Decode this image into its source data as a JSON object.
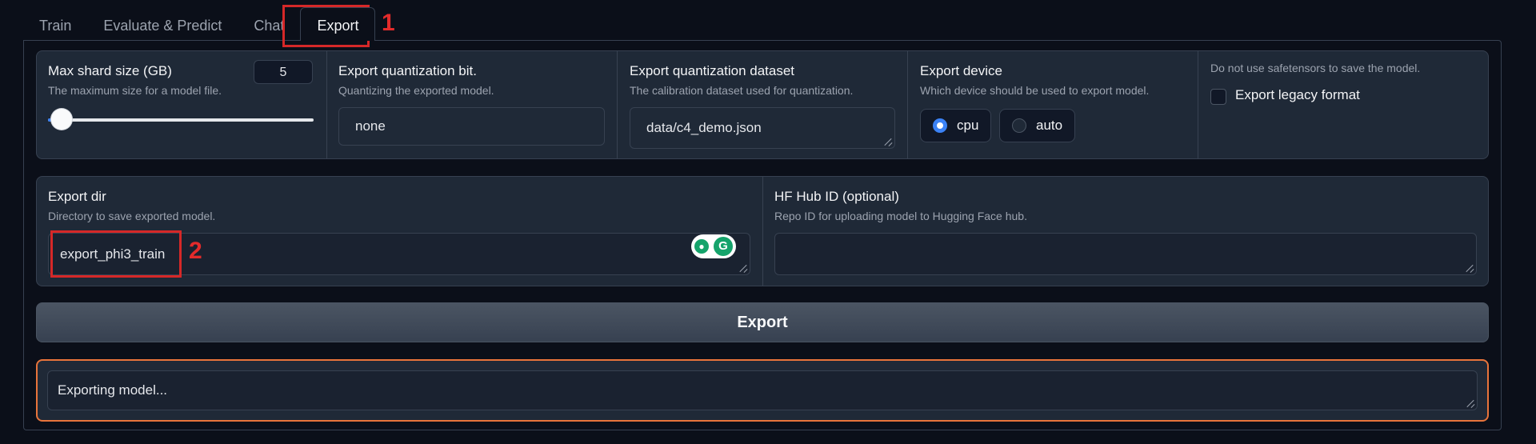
{
  "tabs": [
    "Train",
    "Evaluate & Predict",
    "Chat",
    "Export"
  ],
  "active_tab": "Export",
  "shard": {
    "label": "Max shard size (GB)",
    "desc": "The maximum size for a model file.",
    "value": "5",
    "slider_level": 0.05
  },
  "quant_bit": {
    "label": "Export quantization bit.",
    "desc": "Quantizing the exported model.",
    "value": "none"
  },
  "quant_dataset": {
    "label": "Export quantization dataset",
    "desc": "The calibration dataset used for quantization.",
    "value": "data/c4_demo.json"
  },
  "device": {
    "label": "Export device",
    "desc": "Which device should be used to export model.",
    "options": [
      "cpu",
      "auto"
    ],
    "selected": "cpu"
  },
  "legacy": {
    "desc": "Do not use safetensors to save the model.",
    "label": "Export legacy format",
    "checked": false
  },
  "export_dir": {
    "label": "Export dir",
    "desc": "Directory to save exported model.",
    "value": "export_phi3_train"
  },
  "hub_id": {
    "label": "HF Hub ID (optional)",
    "desc": "Repo ID for uploading model to Hugging Face hub.",
    "value": ""
  },
  "export_button": "Export",
  "status_text": "Exporting model...",
  "annotations": [
    "1",
    "2"
  ],
  "grammarly_icons": [
    "lightbulb-icon",
    "grammarly-g-icon"
  ],
  "grammarly_g": "G",
  "colors": {
    "accent": "#3b82f6",
    "status_border": "#e8743b",
    "annotation_red": "#d62828",
    "grammarly_green": "#15a36b"
  }
}
